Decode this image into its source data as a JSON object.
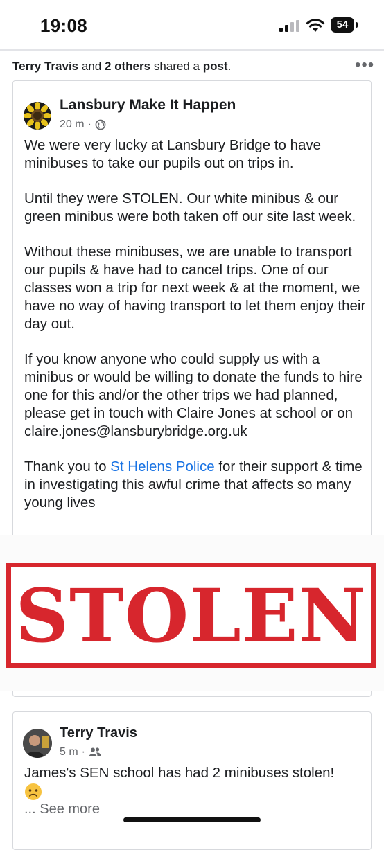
{
  "status_bar": {
    "time": "19:08",
    "battery": "54",
    "icons": [
      "signal-icon",
      "wifi-icon",
      "battery-icon"
    ]
  },
  "shared_header": {
    "user": "Terry Travis",
    "and_text": " and ",
    "others": "2 others",
    "shared_text": " shared a ",
    "post_word": "post",
    "end": ".",
    "menu_icon": "more-dots-icon"
  },
  "post": {
    "page_name": "Lansbury Make It Happen",
    "time_ago": "20 m",
    "dot": "·",
    "privacy_icon": "globe-icon",
    "paragraphs": {
      "p1": "We were very lucky at Lansbury Bridge to have minibuses to take our pupils out on trips in.",
      "p2": "Until they were STOLEN. Our white minibus & our green minibus were both taken off our site last week.",
      "p3": "Without these minibuses, we are unable to transport our pupils & have had to cancel trips. One of our classes won a trip for next week & at the moment, we have no way of having transport to let them enjoy their day out.",
      "p4": "If you know anyone who could supply us with a minibus or would be willing to donate the funds to hire one for this and/or the other trips we had planned, please get in touch with Claire Jones at school or on claire.jones@lansburybridge.org.uk",
      "p5_before": "Thank you to ",
      "p5_link": "St Helens Police",
      "p5_after": " for their support & time in investigating this awful crime that affects so many young lives"
    },
    "image_text": "STOLEN",
    "colors": {
      "stamp_red": "#d7262d",
      "link_blue": "#1b74e4"
    }
  },
  "comment_post": {
    "user": "Terry Travis",
    "time_ago": "5 m",
    "dot": "·",
    "audience_icon": "friends-icon",
    "text": "James's SEN school has had 2 minibuses stolen!",
    "emoji_icon": "sad-face-icon",
    "see_more": "... See more"
  }
}
